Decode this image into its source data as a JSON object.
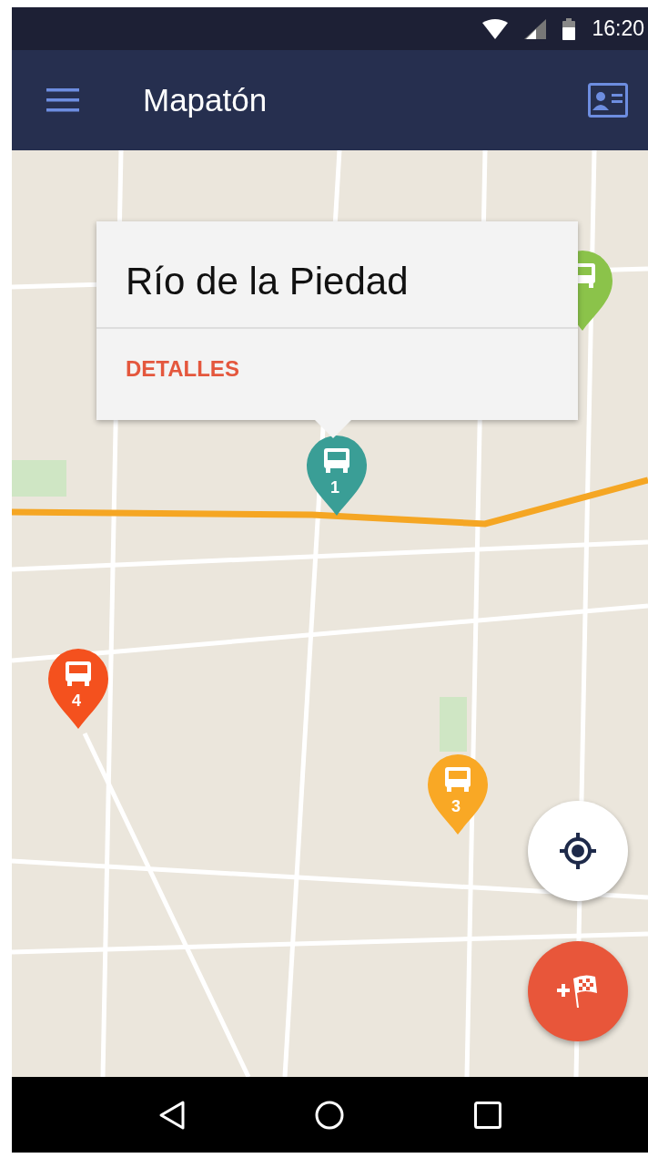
{
  "status_bar": {
    "time": "16:20"
  },
  "app_bar": {
    "title": "Mapatón"
  },
  "markers": [
    {
      "label": "1",
      "color": "#3a9e96"
    },
    {
      "color": "#8bc34a"
    },
    {
      "label": "4",
      "color": "#f4511e"
    },
    {
      "label": "3",
      "color": "#f9a825"
    }
  ],
  "popup": {
    "title": "Río de la Piedad",
    "action": "DETALLES"
  }
}
